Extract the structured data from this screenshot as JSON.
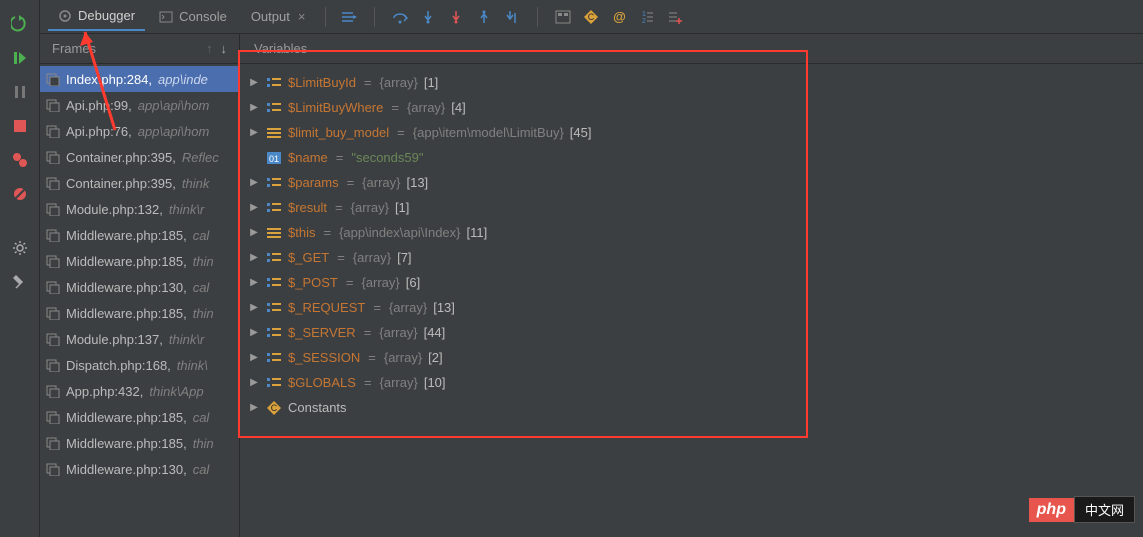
{
  "tabs": {
    "debugger": "Debugger",
    "console": "Console",
    "output": "Output"
  },
  "panels": {
    "frames": "Frames",
    "variables": "Variables"
  },
  "frames": [
    {
      "file": "Index.php:284",
      "path": "app\\inde",
      "selected": true
    },
    {
      "file": "Api.php:99",
      "path": "app\\api\\hom"
    },
    {
      "file": "Api.php:76",
      "path": "app\\api\\hom"
    },
    {
      "file": "Container.php:395",
      "path": "Reflec"
    },
    {
      "file": "Container.php:395",
      "path": "think"
    },
    {
      "file": "Module.php:132",
      "path": "think\\r"
    },
    {
      "file": "Middleware.php:185",
      "path": "cal"
    },
    {
      "file": "Middleware.php:185",
      "path": "thin"
    },
    {
      "file": "Middleware.php:130",
      "path": "cal"
    },
    {
      "file": "Middleware.php:185",
      "path": "thin"
    },
    {
      "file": "Module.php:137",
      "path": "think\\r"
    },
    {
      "file": "Dispatch.php:168",
      "path": "think\\"
    },
    {
      "file": "App.php:432",
      "path": "think\\App"
    },
    {
      "file": "Middleware.php:185",
      "path": "cal"
    },
    {
      "file": "Middleware.php:185",
      "path": "thin"
    },
    {
      "file": "Middleware.php:130",
      "path": "cal"
    }
  ],
  "variables": [
    {
      "kind": "array",
      "name": "$LimitBuyId",
      "type": "{array}",
      "count": "[1]",
      "expandable": true
    },
    {
      "kind": "array",
      "name": "$LimitBuyWhere",
      "type": "{array}",
      "count": "[4]",
      "expandable": true
    },
    {
      "kind": "object",
      "name": "$limit_buy_model",
      "type": "{app\\item\\model\\LimitBuy}",
      "count": "[45]",
      "expandable": true
    },
    {
      "kind": "string",
      "name": "$name",
      "value": "\"seconds59\"",
      "expandable": false
    },
    {
      "kind": "array",
      "name": "$params",
      "type": "{array}",
      "count": "[13]",
      "expandable": true
    },
    {
      "kind": "array",
      "name": "$result",
      "type": "{array}",
      "count": "[1]",
      "expandable": true
    },
    {
      "kind": "object",
      "name": "$this",
      "type": "{app\\index\\api\\Index}",
      "count": "[11]",
      "expandable": true
    },
    {
      "kind": "array",
      "name": "$_GET",
      "type": "{array}",
      "count": "[7]",
      "expandable": true
    },
    {
      "kind": "array",
      "name": "$_POST",
      "type": "{array}",
      "count": "[6]",
      "expandable": true
    },
    {
      "kind": "array",
      "name": "$_REQUEST",
      "type": "{array}",
      "count": "[13]",
      "expandable": true
    },
    {
      "kind": "array",
      "name": "$_SERVER",
      "type": "{array}",
      "count": "[44]",
      "expandable": true
    },
    {
      "kind": "array",
      "name": "$_SESSION",
      "type": "{array}",
      "count": "[2]",
      "expandable": true
    },
    {
      "kind": "array",
      "name": "$GLOBALS",
      "type": "{array}",
      "count": "[10]",
      "expandable": true
    },
    {
      "kind": "constants",
      "name": "Constants",
      "expandable": true
    }
  ],
  "watermark": {
    "left": "php",
    "right": "中文网"
  },
  "icons": {
    "rerun": "rerun",
    "resume": "resume",
    "pause": "pause",
    "stop": "stop",
    "breakpoints": "breakpoints",
    "mute": "mute",
    "settings": "settings",
    "pin": "pin",
    "up": "up",
    "down": "down"
  }
}
